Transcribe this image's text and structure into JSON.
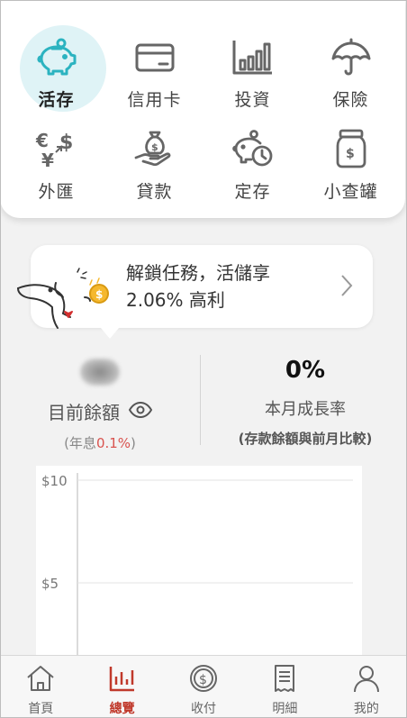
{
  "menu": {
    "items": [
      {
        "label": "活存",
        "icon": "piggy-bank-icon",
        "active": true
      },
      {
        "label": "信用卡",
        "icon": "credit-card-icon"
      },
      {
        "label": "投資",
        "icon": "bar-chart-icon"
      },
      {
        "label": "保險",
        "icon": "umbrella-icon"
      },
      {
        "label": "外匯",
        "icon": "currency-exchange-icon"
      },
      {
        "label": "貸款",
        "icon": "money-bag-hand-icon"
      },
      {
        "label": "定存",
        "icon": "piggy-clock-icon"
      },
      {
        "label": "小查罐",
        "icon": "jar-icon"
      }
    ]
  },
  "promo": {
    "line1": "解鎖任務，活儲享",
    "line2": "2.06% 高利"
  },
  "stats": {
    "balance_label": "目前餘額",
    "interest_prefix": "(年息",
    "interest_rate": "0.1%",
    "interest_suffix": ")",
    "growth_value": "0%",
    "growth_label": "本月成長率",
    "growth_sub": "(存款餘額與前月比較)"
  },
  "chart_data": {
    "type": "line",
    "ytick_labels": [
      "$10",
      "$5"
    ],
    "ylim": [
      0,
      10
    ],
    "grid": true
  },
  "nav": {
    "items": [
      {
        "label": "首頁",
        "icon": "home-icon"
      },
      {
        "label": "總覽",
        "icon": "overview-chart-icon",
        "active": true
      },
      {
        "label": "收付",
        "icon": "coin-icon"
      },
      {
        "label": "明細",
        "icon": "receipt-icon"
      },
      {
        "label": "我的",
        "icon": "user-icon"
      }
    ]
  },
  "colors": {
    "accent_teal": "#2bb3c0",
    "active_bg": "#dff3f6",
    "nav_active": "#c0392b",
    "rate_red": "#d9534f"
  }
}
